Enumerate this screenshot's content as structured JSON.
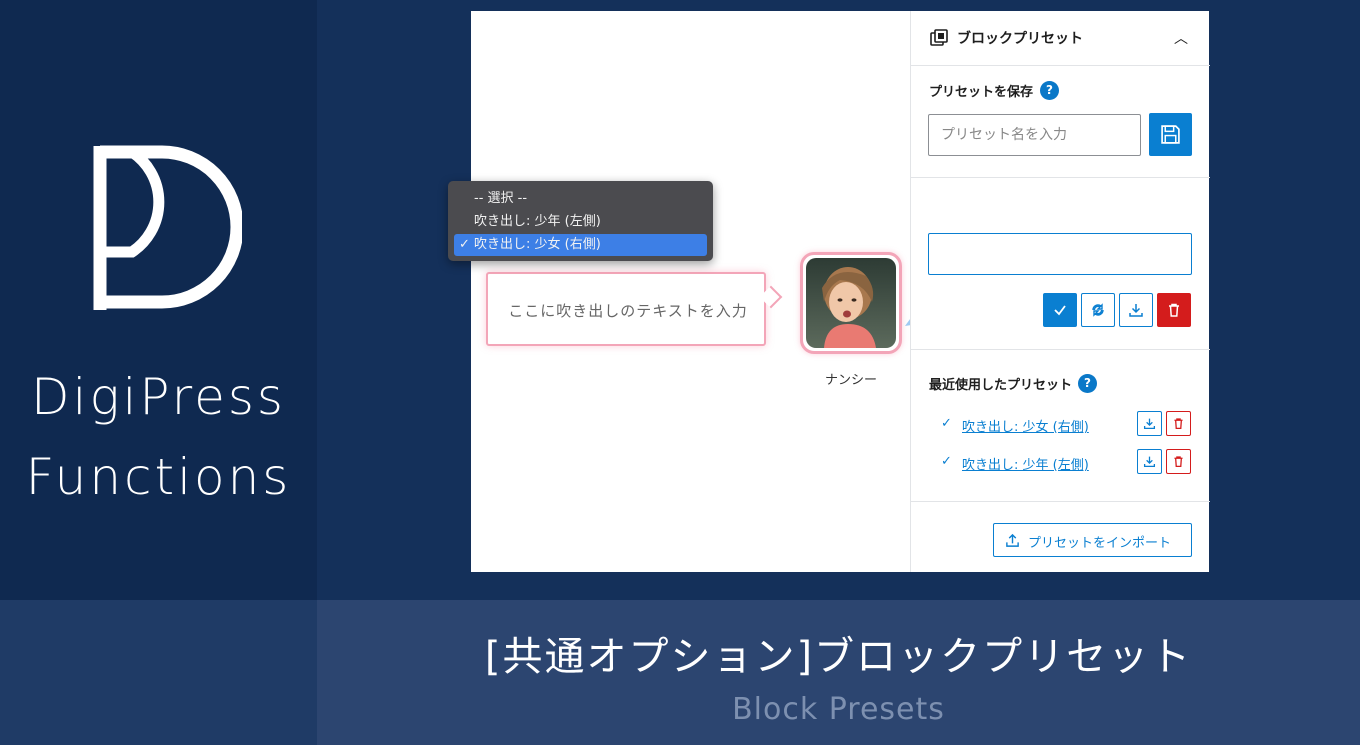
{
  "brand": {
    "line1": "DigiPress",
    "line2": "Functions"
  },
  "footer": {
    "title": "[共通オプション]ブロックプリセット",
    "subtitle": "Block Presets"
  },
  "canvas": {
    "bubble_text": "ここに吹き出しのテキストを入力",
    "avatar_name": "ナンシー"
  },
  "sidebar": {
    "panel_title": "ブロックプリセット",
    "save_section_label": "プリセットを保存",
    "name_input_placeholder": "プリセット名を入力",
    "help_glyph": "?",
    "dropdown_options": [
      "-- 選択 --",
      "吹き出し: 少年 (左側)",
      "吹き出し: 少女 (右側)"
    ],
    "selected_option_index": 2,
    "recent_label": "最近使用したプリセット",
    "recent_items": [
      "吹き出し: 少女 (右側)",
      "吹き出し: 少年 (左側)"
    ],
    "import_label": "プリセットをインポート"
  },
  "colors": {
    "accent": "#0a7fd1",
    "danger": "#d41c1c",
    "bubble_border": "#f3a5b8",
    "brand_bg": "#0f2950",
    "page_bg": "#14305a"
  }
}
